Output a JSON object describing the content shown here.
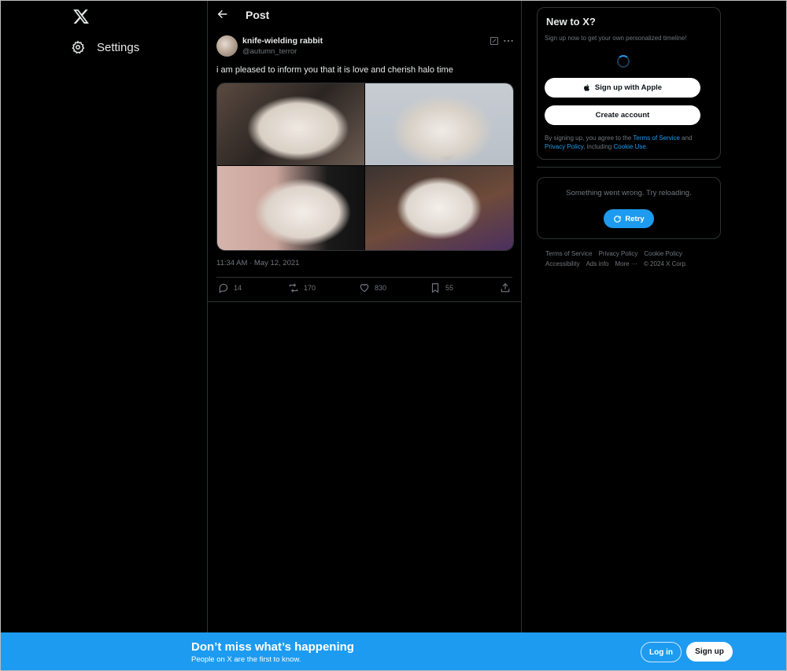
{
  "nav": {
    "logo_icon": "x-logo-icon",
    "settings_icon": "gear-icon",
    "settings_label": "Settings"
  },
  "header": {
    "back_icon": "arrow-left-icon",
    "title": "Post"
  },
  "post": {
    "author_name": "knife-wielding rabbit",
    "author_handle": "@autumn_terror",
    "text": "i am pleased to inform you that it is love and cherish halo time",
    "timestamp": "11:34 AM · May 12, 2021",
    "photos": 4,
    "actions": {
      "replies": "14",
      "reposts": "170",
      "likes": "830",
      "bookmarks": "55"
    }
  },
  "signup_card": {
    "title": "New to X?",
    "subtitle": "Sign up now to get your own personalized timeline!",
    "apple_button": "Sign up with Apple",
    "create_button": "Create account",
    "legal_prefix": "By signing up, you agree to the ",
    "terms_link": "Terms of Service",
    "legal_and": " and ",
    "privacy_link": "Privacy Policy",
    "legal_including": ", including ",
    "cookie_link": "Cookie Use",
    "legal_end": "."
  },
  "error_card": {
    "message": "Something went wrong. Try reloading.",
    "retry_label": "Retry"
  },
  "footer": {
    "links": [
      "Terms of Service",
      "Privacy Policy",
      "Cookie Policy",
      "Accessibility",
      "Ads info",
      "More ···"
    ],
    "copyright": "© 2024 X Corp."
  },
  "banner": {
    "title": "Don’t miss what’s happening",
    "subtitle": "People on X are the first to know.",
    "login_label": "Log in",
    "signup_label": "Sign up"
  },
  "colors": {
    "accent": "#1d9bf0",
    "background": "#000000",
    "border": "#2f3336",
    "muted_text": "#71767b"
  }
}
